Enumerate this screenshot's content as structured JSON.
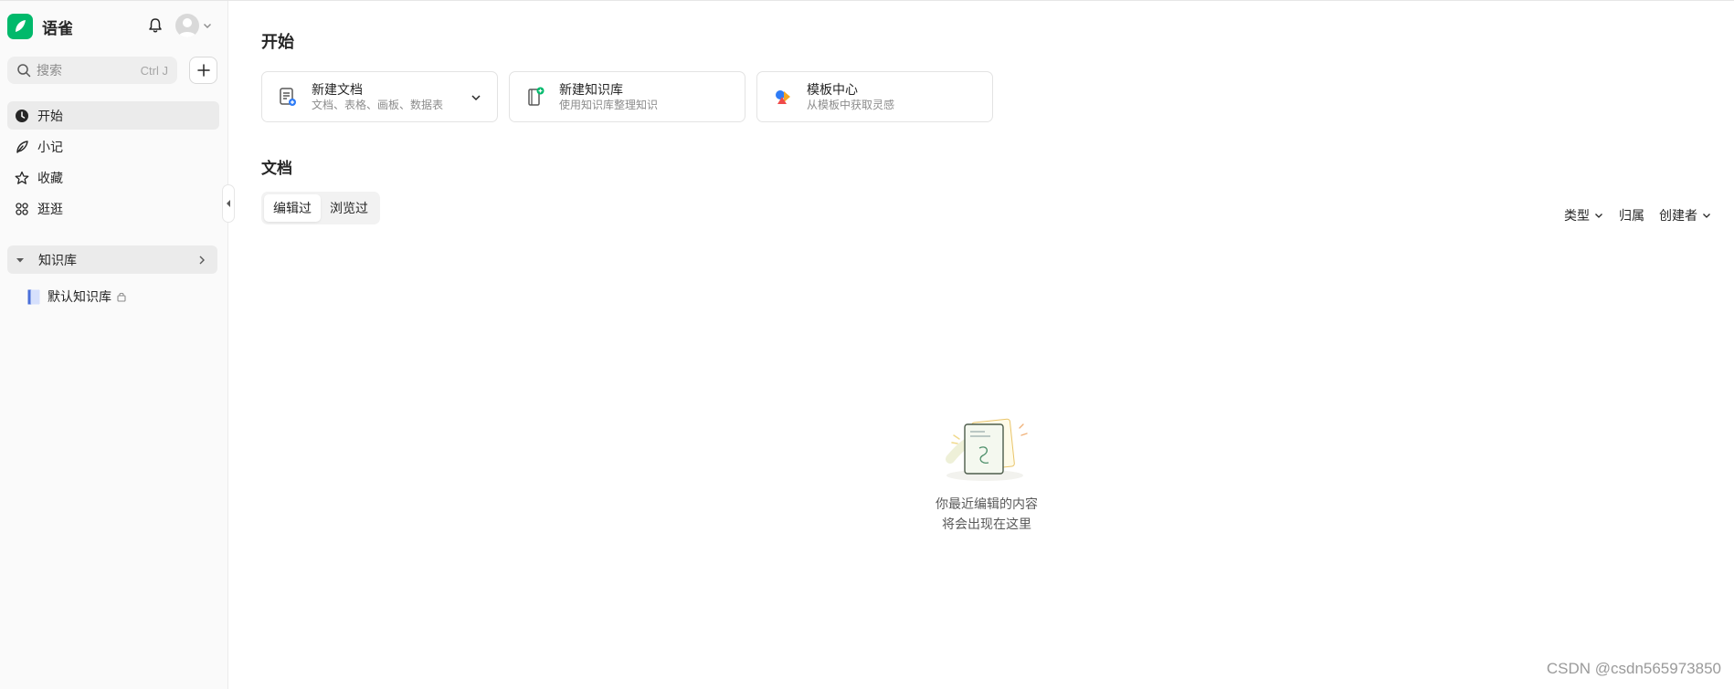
{
  "app": {
    "name": "语雀",
    "brand_color": "#00b96b"
  },
  "sidebar": {
    "search": {
      "placeholder": "搜索",
      "shortcut": "Ctrl J"
    },
    "nav": [
      {
        "label": "开始",
        "icon": "clock-icon",
        "active": true
      },
      {
        "label": "小记",
        "icon": "feather-icon",
        "active": false
      },
      {
        "label": "收藏",
        "icon": "star-icon",
        "active": false
      },
      {
        "label": "逛逛",
        "icon": "grid-icon",
        "active": false
      }
    ],
    "knowledge_base": {
      "header": "知识库",
      "items": [
        {
          "label": "默认知识库",
          "icon": "book-icon",
          "locked": true
        }
      ]
    }
  },
  "main": {
    "start_title": "开始",
    "cards": [
      {
        "title": "新建文档",
        "subtitle": "文档、表格、画板、数据表",
        "icon": "new-doc-icon",
        "has_dropdown": true
      },
      {
        "title": "新建知识库",
        "subtitle": "使用知识库整理知识",
        "icon": "new-kb-icon",
        "has_dropdown": false
      },
      {
        "title": "模板中心",
        "subtitle": "从模板中获取灵感",
        "icon": "template-icon",
        "has_dropdown": false
      }
    ],
    "docs_title": "文档",
    "tabs": [
      {
        "label": "编辑过",
        "active": true
      },
      {
        "label": "浏览过",
        "active": false
      }
    ],
    "filters": [
      {
        "label": "类型",
        "dropdown": true
      },
      {
        "label": "归属",
        "dropdown": false
      },
      {
        "label": "创建者",
        "dropdown": true
      }
    ],
    "empty_state": {
      "line1": "你最近编辑的内容",
      "line2": "将会出现在这里"
    }
  },
  "watermark": "CSDN @csdn565973850"
}
